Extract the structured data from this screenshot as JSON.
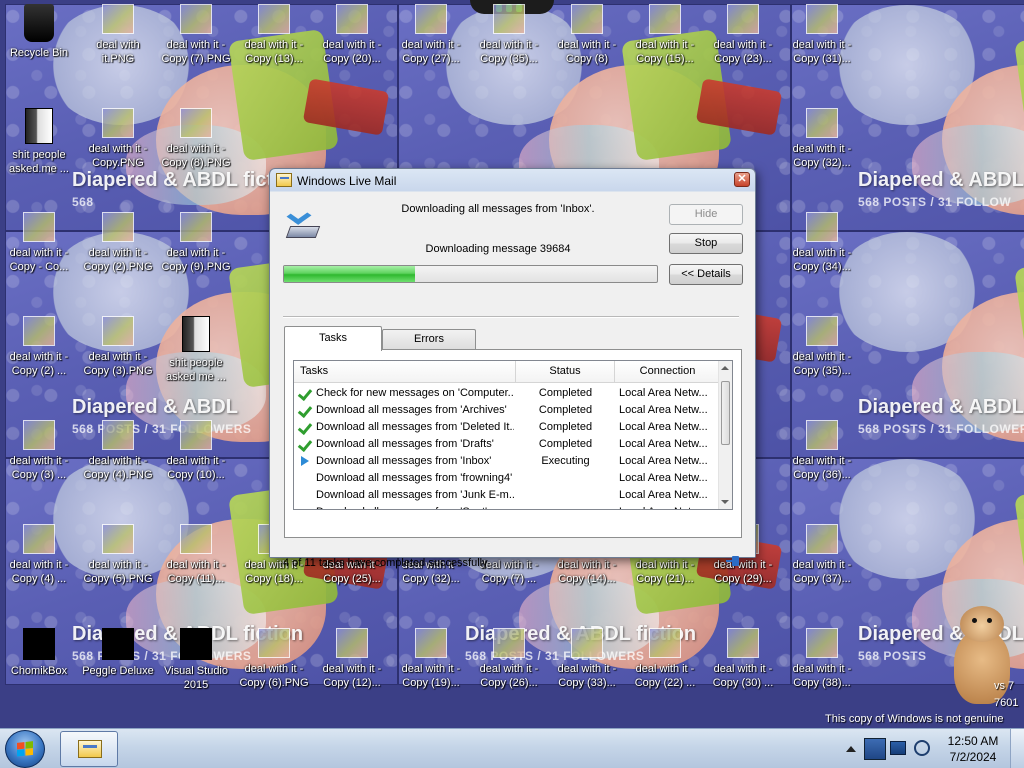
{
  "wallpaper": {
    "tile_title": "Diapered & ABDL fiction",
    "tile_stats": "568 POSTS  /  31 FOLLOWERS",
    "cut_titles": [
      "Diapered & ABDL fi",
      "Diapered & ABDL",
      "Diapered & ABDL fic",
      "Diapered & ABDL"
    ],
    "cut_stats": [
      "568 POSTS  /  31 FOLLOW",
      "568 POSTS  /  31 FOLLOW",
      "568",
      "568 POSTS  /  31 FOLLOWERS",
      "568 POSTS",
      "568 POSTS  /  31 FOLLOWERS"
    ],
    "bottom_stats": [
      "568 POSTS  /  31 FOLLOWERS",
      "568 POSTS  /  31 FOLLOWERS",
      "568 POSTS"
    ]
  },
  "desktop": {
    "row1": [
      {
        "name": "recycle-bin-icon",
        "label": "Recycle Bin",
        "kind": "bin"
      },
      {
        "name": "desktop-file-icon",
        "label": "deal with it.PNG",
        "kind": "thumb"
      },
      {
        "name": "desktop-file-icon",
        "label": "deal with it - Copy (7).PNG",
        "kind": "thumb"
      },
      {
        "name": "desktop-file-icon",
        "label": "deal with it - Copy (13)...",
        "kind": "thumb"
      },
      {
        "name": "desktop-file-icon",
        "label": "deal with it - Copy (20)...",
        "kind": "thumb"
      },
      {
        "name": "desktop-file-icon",
        "label": "deal with it - Copy (27)...",
        "kind": "thumb"
      },
      {
        "name": "desktop-file-icon",
        "label": "deal with it - Copy (35)...",
        "kind": "thumb"
      },
      {
        "name": "desktop-file-icon",
        "label": "deal with it - Copy (8)",
        "kind": "thumb"
      },
      {
        "name": "desktop-file-icon",
        "label": "deal with it - Copy (15)...",
        "kind": "thumb"
      },
      {
        "name": "desktop-file-icon",
        "label": "deal with it - Copy (23)...",
        "kind": "thumb"
      },
      {
        "name": "desktop-file-icon",
        "label": "deal with it - Copy (31)...",
        "kind": "thumb"
      }
    ],
    "row2": [
      {
        "name": "desktop-folder-icon",
        "label": "shit people asked.me ...",
        "kind": "folder"
      },
      {
        "name": "desktop-file-icon",
        "label": "deal with it - Copy.PNG",
        "kind": "thumb"
      },
      {
        "name": "desktop-file-icon",
        "label": "deal with it - Copy (8).PNG",
        "kind": "thumb"
      },
      {
        "name": "desktop-file-icon",
        "label": "deal with it - Copy (32)...",
        "kind": "thumb"
      }
    ],
    "row3": [
      {
        "name": "desktop-file-icon",
        "label": "deal with it - Copy - Co...",
        "kind": "thumb"
      },
      {
        "name": "desktop-file-icon",
        "label": "deal with it - Copy (2).PNG",
        "kind": "thumb"
      },
      {
        "name": "desktop-file-icon",
        "label": "deal with it - Copy (9).PNG",
        "kind": "thumb"
      },
      {
        "name": "desktop-file-icon",
        "label": "deal with it - Copy (34)...",
        "kind": "thumb"
      }
    ],
    "row4": [
      {
        "name": "desktop-file-icon",
        "label": "deal with it - Copy (2) ...",
        "kind": "thumb"
      },
      {
        "name": "desktop-file-icon",
        "label": "deal with it - Copy (3).PNG",
        "kind": "thumb"
      },
      {
        "name": "desktop-folder-icon",
        "label": "shit people asked me ...",
        "kind": "folder"
      },
      {
        "name": "desktop-file-icon",
        "label": "deal with it - Copy (35)...",
        "kind": "thumb"
      }
    ],
    "row5": [
      {
        "name": "desktop-file-icon",
        "label": "deal with it - Copy (3) ...",
        "kind": "thumb"
      },
      {
        "name": "desktop-file-icon",
        "label": "deal with it - Copy (4).PNG",
        "kind": "thumb"
      },
      {
        "name": "desktop-file-icon",
        "label": "deal with it - Copy (10)...",
        "kind": "thumb"
      },
      {
        "name": "desktop-file-icon",
        "label": "deal with it - Copy (36)...",
        "kind": "thumb"
      }
    ],
    "row6": [
      {
        "name": "desktop-file-icon",
        "label": "deal with it - Copy (4) ...",
        "kind": "thumb"
      },
      {
        "name": "desktop-file-icon",
        "label": "deal with it - Copy (5).PNG",
        "kind": "thumb"
      },
      {
        "name": "desktop-file-icon",
        "label": "deal with it - Copy (11)...",
        "kind": "thumb"
      },
      {
        "name": "desktop-file-icon",
        "label": "deal with it - Copy (18)...",
        "kind": "thumb"
      },
      {
        "name": "desktop-file-icon",
        "label": "deal with it - Copy (25)...",
        "kind": "thumb"
      },
      {
        "name": "desktop-file-icon",
        "label": "deal with it - Copy (32)...",
        "kind": "thumb"
      },
      {
        "name": "desktop-file-icon",
        "label": "deal with it - Copy (7) ...",
        "kind": "thumb"
      },
      {
        "name": "desktop-file-icon",
        "label": "deal with it - Copy (14)...",
        "kind": "thumb"
      },
      {
        "name": "desktop-file-icon",
        "label": "deal with it - Copy (21)...",
        "kind": "thumb"
      },
      {
        "name": "desktop-file-icon",
        "label": "deal with it - Copy (29)...",
        "kind": "thumb"
      },
      {
        "name": "desktop-file-icon",
        "label": "deal with it - Copy (37)...",
        "kind": "thumb"
      }
    ],
    "row7": [
      {
        "name": "chomikbox-icon",
        "label": "ChomikBox",
        "kind": "black"
      },
      {
        "name": "peggle-deluxe-icon",
        "label": "Peggle Deluxe",
        "kind": "black"
      },
      {
        "name": "visual-studio-icon",
        "label": "Visual Studio 2015",
        "kind": "black"
      },
      {
        "name": "desktop-file-icon",
        "label": "deal with it - Copy (6).PNG",
        "kind": "thumb"
      },
      {
        "name": "desktop-file-icon",
        "label": "deal with it - Copy (12)...",
        "kind": "thumb"
      },
      {
        "name": "desktop-file-icon",
        "label": "deal with it - Copy (19)...",
        "kind": "thumb"
      },
      {
        "name": "desktop-file-icon",
        "label": "deal with it - Copy (26)...",
        "kind": "thumb"
      },
      {
        "name": "desktop-file-icon",
        "label": "deal with it - Copy (33)...",
        "kind": "thumb"
      },
      {
        "name": "desktop-file-icon",
        "label": "deal with it - Copy (22) ...",
        "kind": "thumb"
      },
      {
        "name": "desktop-file-icon",
        "label": "deal with it - Copy (30) ...",
        "kind": "thumb"
      },
      {
        "name": "desktop-file-icon",
        "label": "deal with it - Copy (38)...",
        "kind": "thumb"
      }
    ]
  },
  "dialog": {
    "title": "Windows Live Mail",
    "message_main": "Downloading all messages from 'Inbox'.",
    "message_detail": "Downloading message 39684",
    "progress_fraction": 0.35,
    "buttons": {
      "hide": "Hide",
      "stop": "Stop",
      "details": "<< Details"
    },
    "tabs": [
      "Tasks",
      "Errors"
    ],
    "columns": [
      "Tasks",
      "Status",
      "Connection"
    ],
    "rows": [
      {
        "icon": "check",
        "task": "Check for new messages on 'Computer...",
        "status": "Completed",
        "connection": "Local Area Netw..."
      },
      {
        "icon": "check",
        "task": "Download all messages from 'Archives'",
        "status": "Completed",
        "connection": "Local Area Netw..."
      },
      {
        "icon": "check",
        "task": "Download all messages from 'Deleted It...",
        "status": "Completed",
        "connection": "Local Area Netw..."
      },
      {
        "icon": "check",
        "task": "Download all messages from 'Drafts'",
        "status": "Completed",
        "connection": "Local Area Netw..."
      },
      {
        "icon": "play",
        "task": "Download all messages from 'Inbox'",
        "status": "Executing",
        "connection": "Local Area Netw..."
      },
      {
        "icon": "none",
        "task": "Download all messages from 'frowning4'",
        "status": "",
        "connection": "Local Area Netw..."
      },
      {
        "icon": "none",
        "task": "Download all messages from 'Junk E-m...",
        "status": "",
        "connection": "Local Area Netw..."
      },
      {
        "icon": "none",
        "task": "Download all messages from 'Sent'",
        "status": "",
        "connection": "Local Area Netw..."
      }
    ],
    "status_text": "4 of 11 tasks have completed successfully"
  },
  "watermark": {
    "line1": "vs 7",
    "line2": "7601",
    "line3": "This copy of Windows is not genuine"
  },
  "taskbar": {
    "time": "12:50 AM",
    "date": "7/2/2024"
  }
}
